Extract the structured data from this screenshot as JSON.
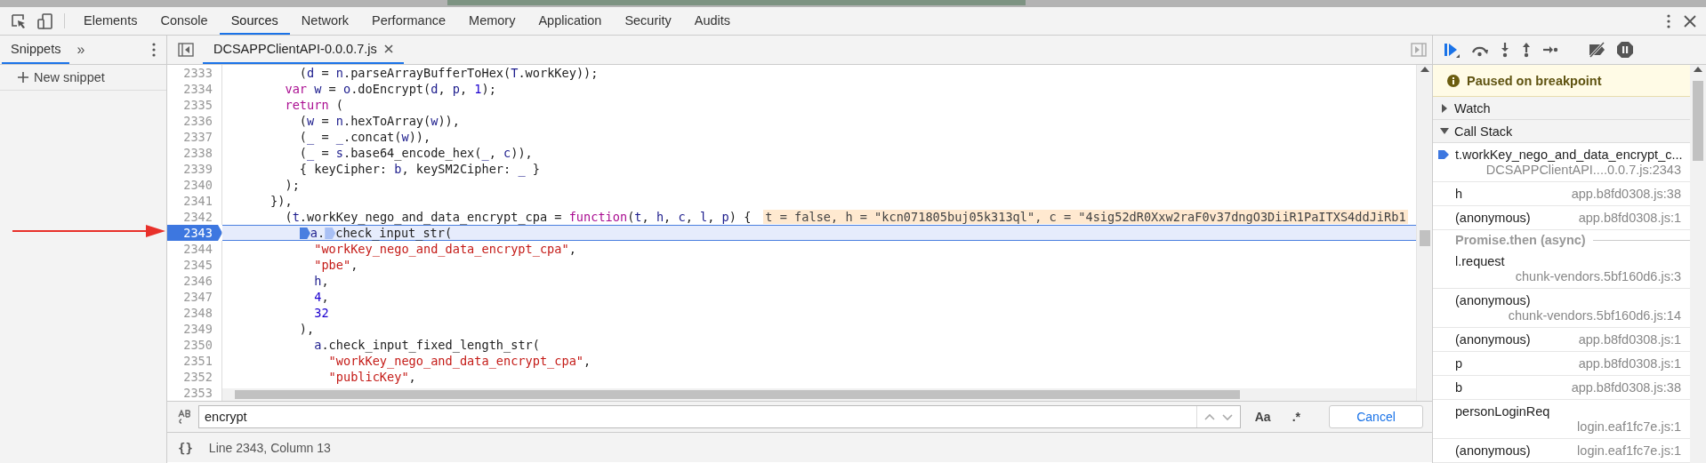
{
  "main_tabs": [
    {
      "label": "Elements",
      "selected": false
    },
    {
      "label": "Console",
      "selected": false
    },
    {
      "label": "Sources",
      "selected": true
    },
    {
      "label": "Network",
      "selected": false
    },
    {
      "label": "Performance",
      "selected": false
    },
    {
      "label": "Memory",
      "selected": false
    },
    {
      "label": "Application",
      "selected": false
    },
    {
      "label": "Security",
      "selected": false
    },
    {
      "label": "Audits",
      "selected": false
    }
  ],
  "navigator": {
    "tabs": [
      {
        "label": "Snippets",
        "selected": true
      }
    ],
    "more": "»",
    "new_snippet": "New snippet"
  },
  "editor": {
    "file_tabs": [
      {
        "label": "DCSAPPClientAPI-0.0.0.7.js",
        "selected": true
      }
    ],
    "lines": [
      {
        "number": "2333",
        "breakpoint": false,
        "current": false,
        "tokens": [
          {
            "kind": "plain",
            "text": "          ("
          },
          {
            "kind": "ident",
            "text": "d"
          },
          {
            "kind": "plain",
            "text": " = "
          },
          {
            "kind": "ident",
            "text": "n"
          },
          {
            "kind": "plain",
            "text": ".parseArrayBufferToHex("
          },
          {
            "kind": "ident",
            "text": "T"
          },
          {
            "kind": "plain",
            "text": ".workKey));"
          }
        ]
      },
      {
        "number": "2334",
        "breakpoint": false,
        "current": false,
        "tokens": [
          {
            "kind": "keyword",
            "text": "        var "
          },
          {
            "kind": "ident",
            "text": "w"
          },
          {
            "kind": "plain",
            "text": " = "
          },
          {
            "kind": "ident",
            "text": "o"
          },
          {
            "kind": "plain",
            "text": ".doEncrypt("
          },
          {
            "kind": "ident",
            "text": "d"
          },
          {
            "kind": "plain",
            "text": ", "
          },
          {
            "kind": "ident",
            "text": "p"
          },
          {
            "kind": "plain",
            "text": ", "
          },
          {
            "kind": "number",
            "text": "1"
          },
          {
            "kind": "plain",
            "text": ");"
          }
        ]
      },
      {
        "number": "2335",
        "breakpoint": false,
        "current": false,
        "tokens": [
          {
            "kind": "keyword",
            "text": "        return"
          },
          {
            "kind": "plain",
            "text": " ("
          }
        ]
      },
      {
        "number": "2336",
        "breakpoint": false,
        "current": false,
        "tokens": [
          {
            "kind": "plain",
            "text": "          ("
          },
          {
            "kind": "ident",
            "text": "w"
          },
          {
            "kind": "plain",
            "text": " = "
          },
          {
            "kind": "ident",
            "text": "n"
          },
          {
            "kind": "plain",
            "text": ".hexToArray("
          },
          {
            "kind": "ident",
            "text": "w"
          },
          {
            "kind": "plain",
            "text": ")),"
          }
        ]
      },
      {
        "number": "2337",
        "breakpoint": false,
        "current": false,
        "tokens": [
          {
            "kind": "plain",
            "text": "          ("
          },
          {
            "kind": "ident",
            "text": "_"
          },
          {
            "kind": "plain",
            "text": " = "
          },
          {
            "kind": "ident",
            "text": "_"
          },
          {
            "kind": "plain",
            "text": ".concat("
          },
          {
            "kind": "ident",
            "text": "w"
          },
          {
            "kind": "plain",
            "text": ")),"
          }
        ]
      },
      {
        "number": "2338",
        "breakpoint": false,
        "current": false,
        "tokens": [
          {
            "kind": "plain",
            "text": "          ("
          },
          {
            "kind": "ident",
            "text": "_"
          },
          {
            "kind": "plain",
            "text": " = "
          },
          {
            "kind": "ident",
            "text": "s"
          },
          {
            "kind": "plain",
            "text": ".base64_encode_hex("
          },
          {
            "kind": "ident",
            "text": "_"
          },
          {
            "kind": "plain",
            "text": ", "
          },
          {
            "kind": "ident",
            "text": "c"
          },
          {
            "kind": "plain",
            "text": ")),"
          }
        ]
      },
      {
        "number": "2339",
        "breakpoint": false,
        "current": false,
        "tokens": [
          {
            "kind": "plain",
            "text": "          { keyCipher: "
          },
          {
            "kind": "ident",
            "text": "b"
          },
          {
            "kind": "plain",
            "text": ", keySM2Cipher: "
          },
          {
            "kind": "ident",
            "text": "_"
          },
          {
            "kind": "plain",
            "text": " }"
          }
        ]
      },
      {
        "number": "2340",
        "breakpoint": false,
        "current": false,
        "tokens": [
          {
            "kind": "plain",
            "text": "        );"
          }
        ]
      },
      {
        "number": "2341",
        "breakpoint": false,
        "current": false,
        "tokens": [
          {
            "kind": "plain",
            "text": "      }),"
          }
        ]
      },
      {
        "number": "2342",
        "breakpoint": false,
        "current": false,
        "tokens": [
          {
            "kind": "plain",
            "text": "        ("
          },
          {
            "kind": "ident",
            "text": "t"
          },
          {
            "kind": "plain",
            "text": ".workKey_nego_and_data_encrypt_cpa = "
          },
          {
            "kind": "keyword",
            "text": "function"
          },
          {
            "kind": "plain",
            "text": "("
          },
          {
            "kind": "ident",
            "text": "t"
          },
          {
            "kind": "plain",
            "text": ", "
          },
          {
            "kind": "ident",
            "text": "h"
          },
          {
            "kind": "plain",
            "text": ", "
          },
          {
            "kind": "ident",
            "text": "c"
          },
          {
            "kind": "plain",
            "text": ", "
          },
          {
            "kind": "ident",
            "text": "l"
          },
          {
            "kind": "plain",
            "text": ", "
          },
          {
            "kind": "ident",
            "text": "p"
          },
          {
            "kind": "plain",
            "text": ") {"
          }
        ],
        "inline_values": "t = false, h = \"kcn071805buj05k313ql\", c = \"4sig52dR0Xxw2raF0v37dngO3DiiR1PaITXS4ddJiRb1"
      },
      {
        "number": "2343",
        "breakpoint": true,
        "current": true,
        "tokens": [
          {
            "kind": "ident",
            "text": "          a",
            "marker_active": true
          },
          {
            "kind": "plain",
            "text": "."
          },
          {
            "kind": "plain",
            "text": "check_input_str(",
            "marker_active": false
          }
        ]
      },
      {
        "number": "2344",
        "breakpoint": false,
        "current": false,
        "tokens": [
          {
            "kind": "string",
            "text": "            \"workKey_nego_and_data_encrypt_cpa\""
          },
          {
            "kind": "plain",
            "text": ","
          }
        ]
      },
      {
        "number": "2345",
        "breakpoint": false,
        "current": false,
        "tokens": [
          {
            "kind": "string",
            "text": "            \"pbe\""
          },
          {
            "kind": "plain",
            "text": ","
          }
        ]
      },
      {
        "number": "2346",
        "breakpoint": false,
        "current": false,
        "tokens": [
          {
            "kind": "ident",
            "text": "            h"
          },
          {
            "kind": "plain",
            "text": ","
          }
        ]
      },
      {
        "number": "2347",
        "breakpoint": false,
        "current": false,
        "tokens": [
          {
            "kind": "number",
            "text": "            4"
          },
          {
            "kind": "plain",
            "text": ","
          }
        ]
      },
      {
        "number": "2348",
        "breakpoint": false,
        "current": false,
        "tokens": [
          {
            "kind": "number",
            "text": "            32"
          }
        ]
      },
      {
        "number": "2349",
        "breakpoint": false,
        "current": false,
        "tokens": [
          {
            "kind": "plain",
            "text": "          ),"
          }
        ]
      },
      {
        "number": "2350",
        "breakpoint": false,
        "current": false,
        "tokens": [
          {
            "kind": "ident",
            "text": "            a"
          },
          {
            "kind": "plain",
            "text": ".check_input_fixed_length_str("
          }
        ]
      },
      {
        "number": "2351",
        "breakpoint": false,
        "current": false,
        "tokens": [
          {
            "kind": "string",
            "text": "              \"workKey_nego_and_data_encrypt_cpa\""
          },
          {
            "kind": "plain",
            "text": ","
          }
        ]
      },
      {
        "number": "2352",
        "breakpoint": false,
        "current": false,
        "tokens": [
          {
            "kind": "string",
            "text": "              \"publicKey\""
          },
          {
            "kind": "plain",
            "text": ","
          }
        ]
      },
      {
        "number": "2353",
        "breakpoint": false,
        "current": false
      }
    ]
  },
  "search": {
    "value": "encrypt",
    "case_button": "Aa",
    "regex_button": ".*",
    "cancel": "Cancel"
  },
  "status_bar": {
    "format_button": "{}",
    "text": "Line 2343, Column 13"
  },
  "debugger": {
    "paused_message": "Paused on breakpoint",
    "sections": [
      {
        "title": "Watch",
        "expanded": false
      },
      {
        "title": "Call Stack",
        "expanded": true,
        "frames": [
          {
            "kind": "frame",
            "name": "t.workKey_nego_and_data_encrypt_c...",
            "location": "DCSAPPClientAPI....0.0.7.js:2343",
            "selected": true
          },
          {
            "kind": "frame",
            "name": "h",
            "location": "app.b8fd0308.js:38",
            "selected": false
          },
          {
            "kind": "frame",
            "name": "(anonymous)",
            "location": "app.b8fd0308.js:1",
            "selected": false
          },
          {
            "kind": "async",
            "name": "Promise.then (async)"
          },
          {
            "kind": "frame",
            "name": "l.request",
            "location": "chunk-vendors.5bf160d6.js:3",
            "selected": false
          },
          {
            "kind": "frame",
            "name": "(anonymous)",
            "location": "chunk-vendors.5bf160d6.js:14",
            "selected": false
          },
          {
            "kind": "frame",
            "name": "(anonymous)",
            "location": "app.b8fd0308.js:1",
            "selected": false
          },
          {
            "kind": "frame",
            "name": "p",
            "location": "app.b8fd0308.js:1",
            "selected": false
          },
          {
            "kind": "frame",
            "name": "b",
            "location": "app.b8fd0308.js:38",
            "selected": false
          },
          {
            "kind": "frame",
            "name": "personLoginReq",
            "location": "login.eaf1fc7e.js:1",
            "selected": false
          },
          {
            "kind": "frame",
            "name": "(anonymous)",
            "location": "login.eaf1fc7e.js:1",
            "selected": false
          }
        ]
      }
    ]
  }
}
